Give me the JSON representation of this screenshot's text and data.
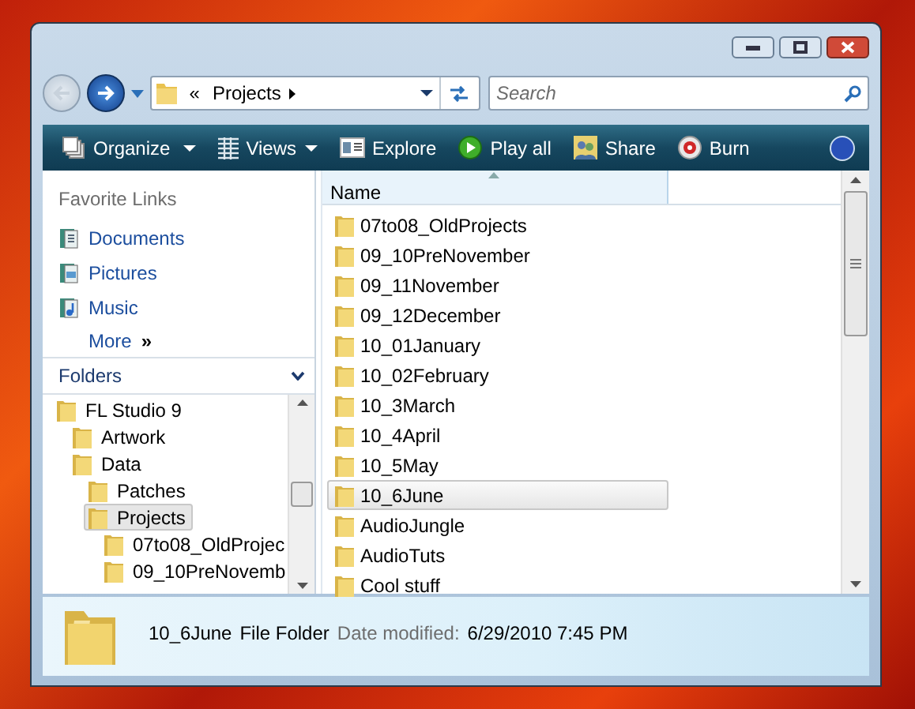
{
  "address_bar": {
    "overflow": "«",
    "path": "Projects"
  },
  "search": {
    "placeholder": "Search"
  },
  "toolbar": [
    {
      "label": "Organize",
      "has_menu": true
    },
    {
      "label": "Views",
      "has_menu": true
    },
    {
      "label": "Explore",
      "has_menu": false
    },
    {
      "label": "Play all",
      "has_menu": false
    },
    {
      "label": "Share",
      "has_menu": false
    },
    {
      "label": "Burn",
      "has_menu": false
    }
  ],
  "favorite_links": {
    "title": "Favorite Links",
    "items": [
      {
        "label": "Documents"
      },
      {
        "label": "Pictures"
      },
      {
        "label": "Music"
      }
    ],
    "more": "More",
    "more_glyph": "»"
  },
  "folders": {
    "title": "Folders",
    "tree": [
      {
        "label": "FL Studio 9",
        "selected": false,
        "children": [
          {
            "label": "Artwork",
            "selected": false
          },
          {
            "label": "Data",
            "selected": false,
            "children": [
              {
                "label": "Patches",
                "selected": false
              },
              {
                "label": "Projects",
                "selected": true,
                "children": [
                  {
                    "label": "07to08_OldProjec",
                    "selected": false
                  },
                  {
                    "label": "09_10PreNovemb",
                    "selected": false
                  }
                ]
              }
            ]
          }
        ]
      }
    ]
  },
  "file_list": {
    "columns": [
      "Name"
    ],
    "rows": [
      {
        "name": "07to08_OldProjects",
        "selected": false
      },
      {
        "name": "09_10PreNovember",
        "selected": false
      },
      {
        "name": "09_11November",
        "selected": false
      },
      {
        "name": "09_12December",
        "selected": false
      },
      {
        "name": "10_01January",
        "selected": false
      },
      {
        "name": "10_02February",
        "selected": false
      },
      {
        "name": "10_3March",
        "selected": false
      },
      {
        "name": "10_4April",
        "selected": false
      },
      {
        "name": "10_5May",
        "selected": false
      },
      {
        "name": "10_6June",
        "selected": true
      },
      {
        "name": "AudioJungle",
        "selected": false
      },
      {
        "name": "AudioTuts",
        "selected": false
      },
      {
        "name": "Cool stuff",
        "selected": false
      }
    ]
  },
  "details_pane": {
    "name": "10_6June",
    "type": "File Folder",
    "date_label": "Date modified:",
    "date": "6/29/2010 7:45 PM"
  }
}
